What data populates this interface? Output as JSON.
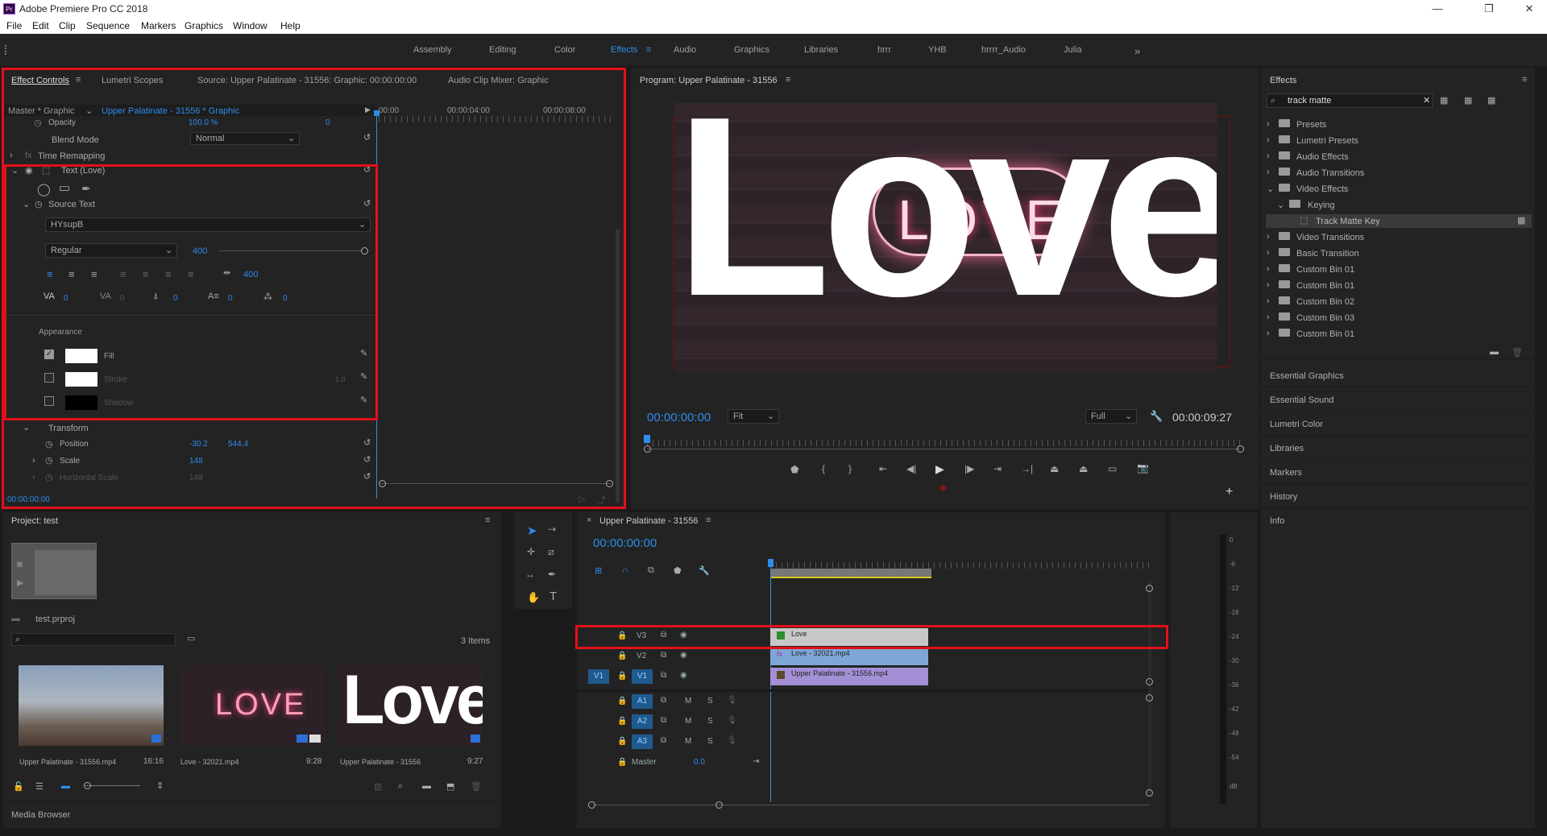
{
  "app": {
    "title": "Adobe Premiere Pro CC 2018"
  },
  "menu": [
    "File",
    "Edit",
    "Clip",
    "Sequence",
    "Markers",
    "Graphics",
    "Window",
    "Help"
  ],
  "workspaces": [
    "Assembly",
    "Editing",
    "Color",
    "Effects",
    "Audio",
    "Graphics",
    "Libraries",
    "hrrr",
    "YHB",
    "hrrrr_Audio",
    "Julia"
  ],
  "workspace_active": "Effects",
  "effect_controls": {
    "tabs": [
      "Effect Controls",
      "Lumetri Scopes",
      "Source: Upper Palatinate - 31556: Graphic: 00:00:00:00",
      "Audio Clip Mixer: Graphic"
    ],
    "master": "Master * Graphic",
    "clip": "Upper Palatinate - 31556 * Graphic",
    "ruler": [
      "00:00",
      "00:00:04:00",
      "00:00:08:00"
    ],
    "opacity_label": "Opacity",
    "opacity_value": "100.0 %",
    "opacity_kf": "0",
    "blend_label": "Blend Mode",
    "blend_value": "Normal",
    "time_remap": "Time Remapping",
    "text_layer": "Text (Love)",
    "source_text": "Source Text",
    "font": "HYsupB",
    "style": "Regular",
    "size": "400",
    "tracking_value": "400",
    "metrics": [
      "0",
      "0",
      "0",
      "0",
      "0"
    ],
    "appearance": "Appearance",
    "fill": "Fill",
    "stroke": "Stroke",
    "stroke_width": "1.0",
    "shadow": "Shadow",
    "transform": "Transform",
    "position_label": "Position",
    "position_x": "-30.2",
    "position_y": "544.4",
    "scale_label": "Scale",
    "scale_value": "148",
    "hscale_label": "Horizontal Scale",
    "hscale_value": "148",
    "timecode": "00:00:00:00"
  },
  "program": {
    "title": "Program: Upper Palatinate - 31556",
    "word": "Love",
    "neon": "LOVE",
    "timecode": "00:00:00:00",
    "fit": "Fit",
    "quality": "Full",
    "duration": "00:00:09:27"
  },
  "effects_panel": {
    "title": "Effects",
    "search": "track matte",
    "items": [
      "Presets",
      "Lumetri Presets",
      "Audio Effects",
      "Audio Transitions",
      "Video Effects",
      "Keying",
      "Track Matte Key",
      "Video Transitions",
      "Basic Transition",
      "Custom Bin 01",
      "Custom Bin 01",
      "Custom Bin 02",
      "Custom Bin 03",
      "Custom Bin 01"
    ],
    "sections": [
      "Essential Graphics",
      "Essential Sound",
      "Lumetri Color",
      "Libraries",
      "Markers",
      "History",
      "Info"
    ]
  },
  "project": {
    "title": "Project: test",
    "file": "test.prproj",
    "count": "3 Items",
    "items": [
      {
        "name": "Upper Palatinate - 31556.mp4",
        "dur": "16:16"
      },
      {
        "name": "Love - 32021.mp4",
        "dur": "9:28"
      },
      {
        "name": "Upper Palatinate - 31556",
        "dur": "9:27"
      }
    ],
    "thumb_neon": "LOVE",
    "thumb_word": "Love",
    "media_browser": "Media Browser"
  },
  "timeline": {
    "title": "Upper Palatinate - 31556",
    "timecode": "00:00:00:00",
    "video_tracks": [
      "V3",
      "V2",
      "V1"
    ],
    "audio_tracks": [
      "A1",
      "A2",
      "A3"
    ],
    "source_patch": "V1",
    "clips": [
      "Love",
      "Love - 32021.mp4",
      "Upper Palatinate - 31556.mp4"
    ],
    "master": "Master",
    "master_value": "0.0",
    "meter": [
      "0",
      "-6",
      "-12",
      "-18",
      "-24",
      "-30",
      "-36",
      "-42",
      "-48",
      "-54",
      "dB"
    ]
  },
  "colors": {
    "accent": "#2d8ceb",
    "highlight": "#e3101a",
    "clip_v3": "#c8c8c8",
    "clip_v2": "#7fa7d6",
    "clip_v1": "#a390d6"
  }
}
